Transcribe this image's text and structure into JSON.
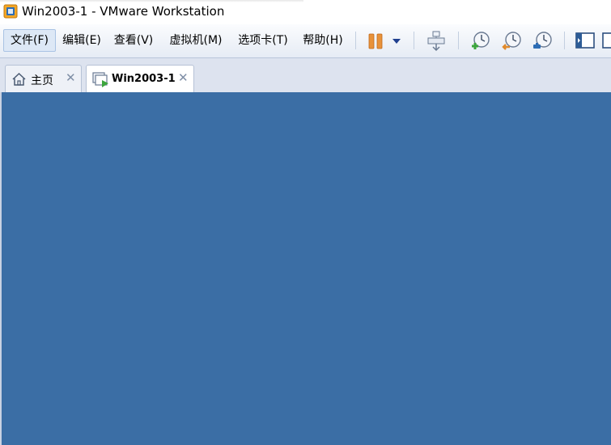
{
  "window": {
    "title": "Win2003-1 - VMware Workstation",
    "app_icon": "vmware-icon"
  },
  "menu": {
    "items": [
      {
        "label": "文件(F)",
        "active": true
      },
      {
        "label": "编辑(E)"
      },
      {
        "label": "查看(V)"
      },
      {
        "label": "虚拟机(M)"
      },
      {
        "label": "选项卡(T)"
      },
      {
        "label": "帮助(H)"
      }
    ]
  },
  "toolbar": {
    "icons": [
      "pause-icon",
      "dropdown-arrow-icon",
      "send-ctrl-alt-del-icon",
      "snapshot-take-icon",
      "snapshot-revert-icon",
      "snapshot-manager-icon",
      "console-view-icon"
    ]
  },
  "tabs": [
    {
      "label": "主页",
      "icon": "home-icon",
      "selected": false
    },
    {
      "label": "Win2003-1",
      "icon": "vm-running-icon",
      "selected": true
    }
  ],
  "vm_screen": {
    "background_color": "#3b6ea5"
  }
}
